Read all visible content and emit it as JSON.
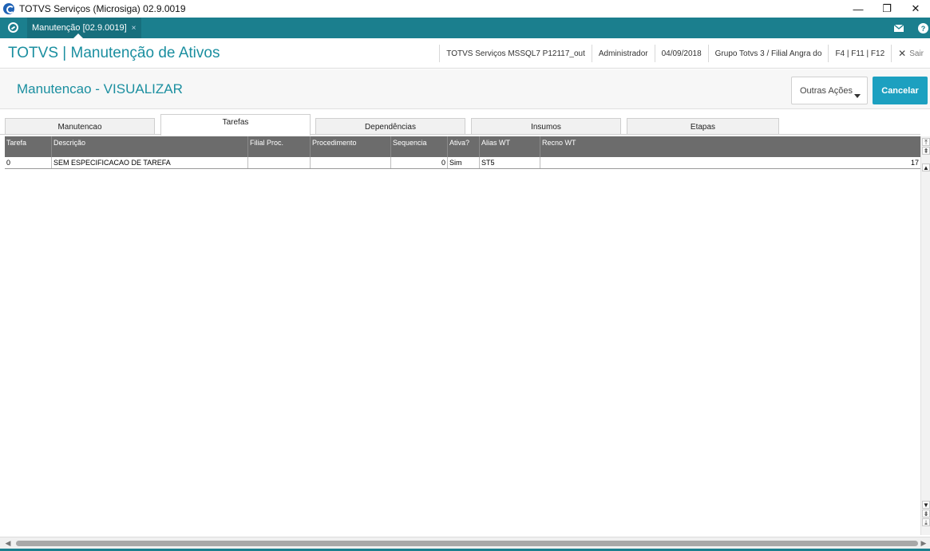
{
  "window": {
    "title": "TOTVS Serviços (Microsiga) 02.9.0019",
    "controls": {
      "minimize": "—",
      "restore": "❐",
      "close": "✕"
    }
  },
  "app_tab": {
    "label": "Manutenção [02.9.0019]",
    "close": "×",
    "icons": [
      "mail-icon",
      "help-icon"
    ]
  },
  "header": {
    "app_title": "TOTVS | Manutenção de Ativos",
    "environment": "TOTVS Serviços MSSQL7 P12117_out",
    "user": "Administrador",
    "date": "04/09/2018",
    "branch": "Grupo Totvs 3 / Filial Angra do",
    "shortcuts": "F4 | F11 | F12",
    "exit_icon": "✕",
    "exit_label": "Sair"
  },
  "actionbar": {
    "page_title": "Manutencao - VISUALIZAR",
    "more_actions": "Outras Ações",
    "cancel": "Cancelar"
  },
  "tabs": [
    {
      "label": "Manutencao",
      "active": false
    },
    {
      "label": "Tarefas",
      "active": true
    },
    {
      "label": "Dependências",
      "active": false
    },
    {
      "label": "Insumos",
      "active": false
    },
    {
      "label": "Etapas",
      "active": false
    }
  ],
  "grid": {
    "columns": [
      "Tarefa",
      "Descrição",
      "Filial Proc.",
      "Procedimento",
      "Sequencia",
      "Ativa?",
      "Alias WT",
      "Recno WT"
    ],
    "rows": [
      [
        "0",
        "SEM ESPECIFICACAO DE TAREFA",
        "",
        "",
        "0",
        "Sim",
        "ST5",
        "17"
      ]
    ]
  },
  "scroll": {
    "top": "⤒",
    "page_up": "⇞",
    "up": "▲",
    "down": "▼",
    "page_down": "⇟",
    "bottom": "⤓",
    "left": "◀",
    "right": "▶"
  }
}
